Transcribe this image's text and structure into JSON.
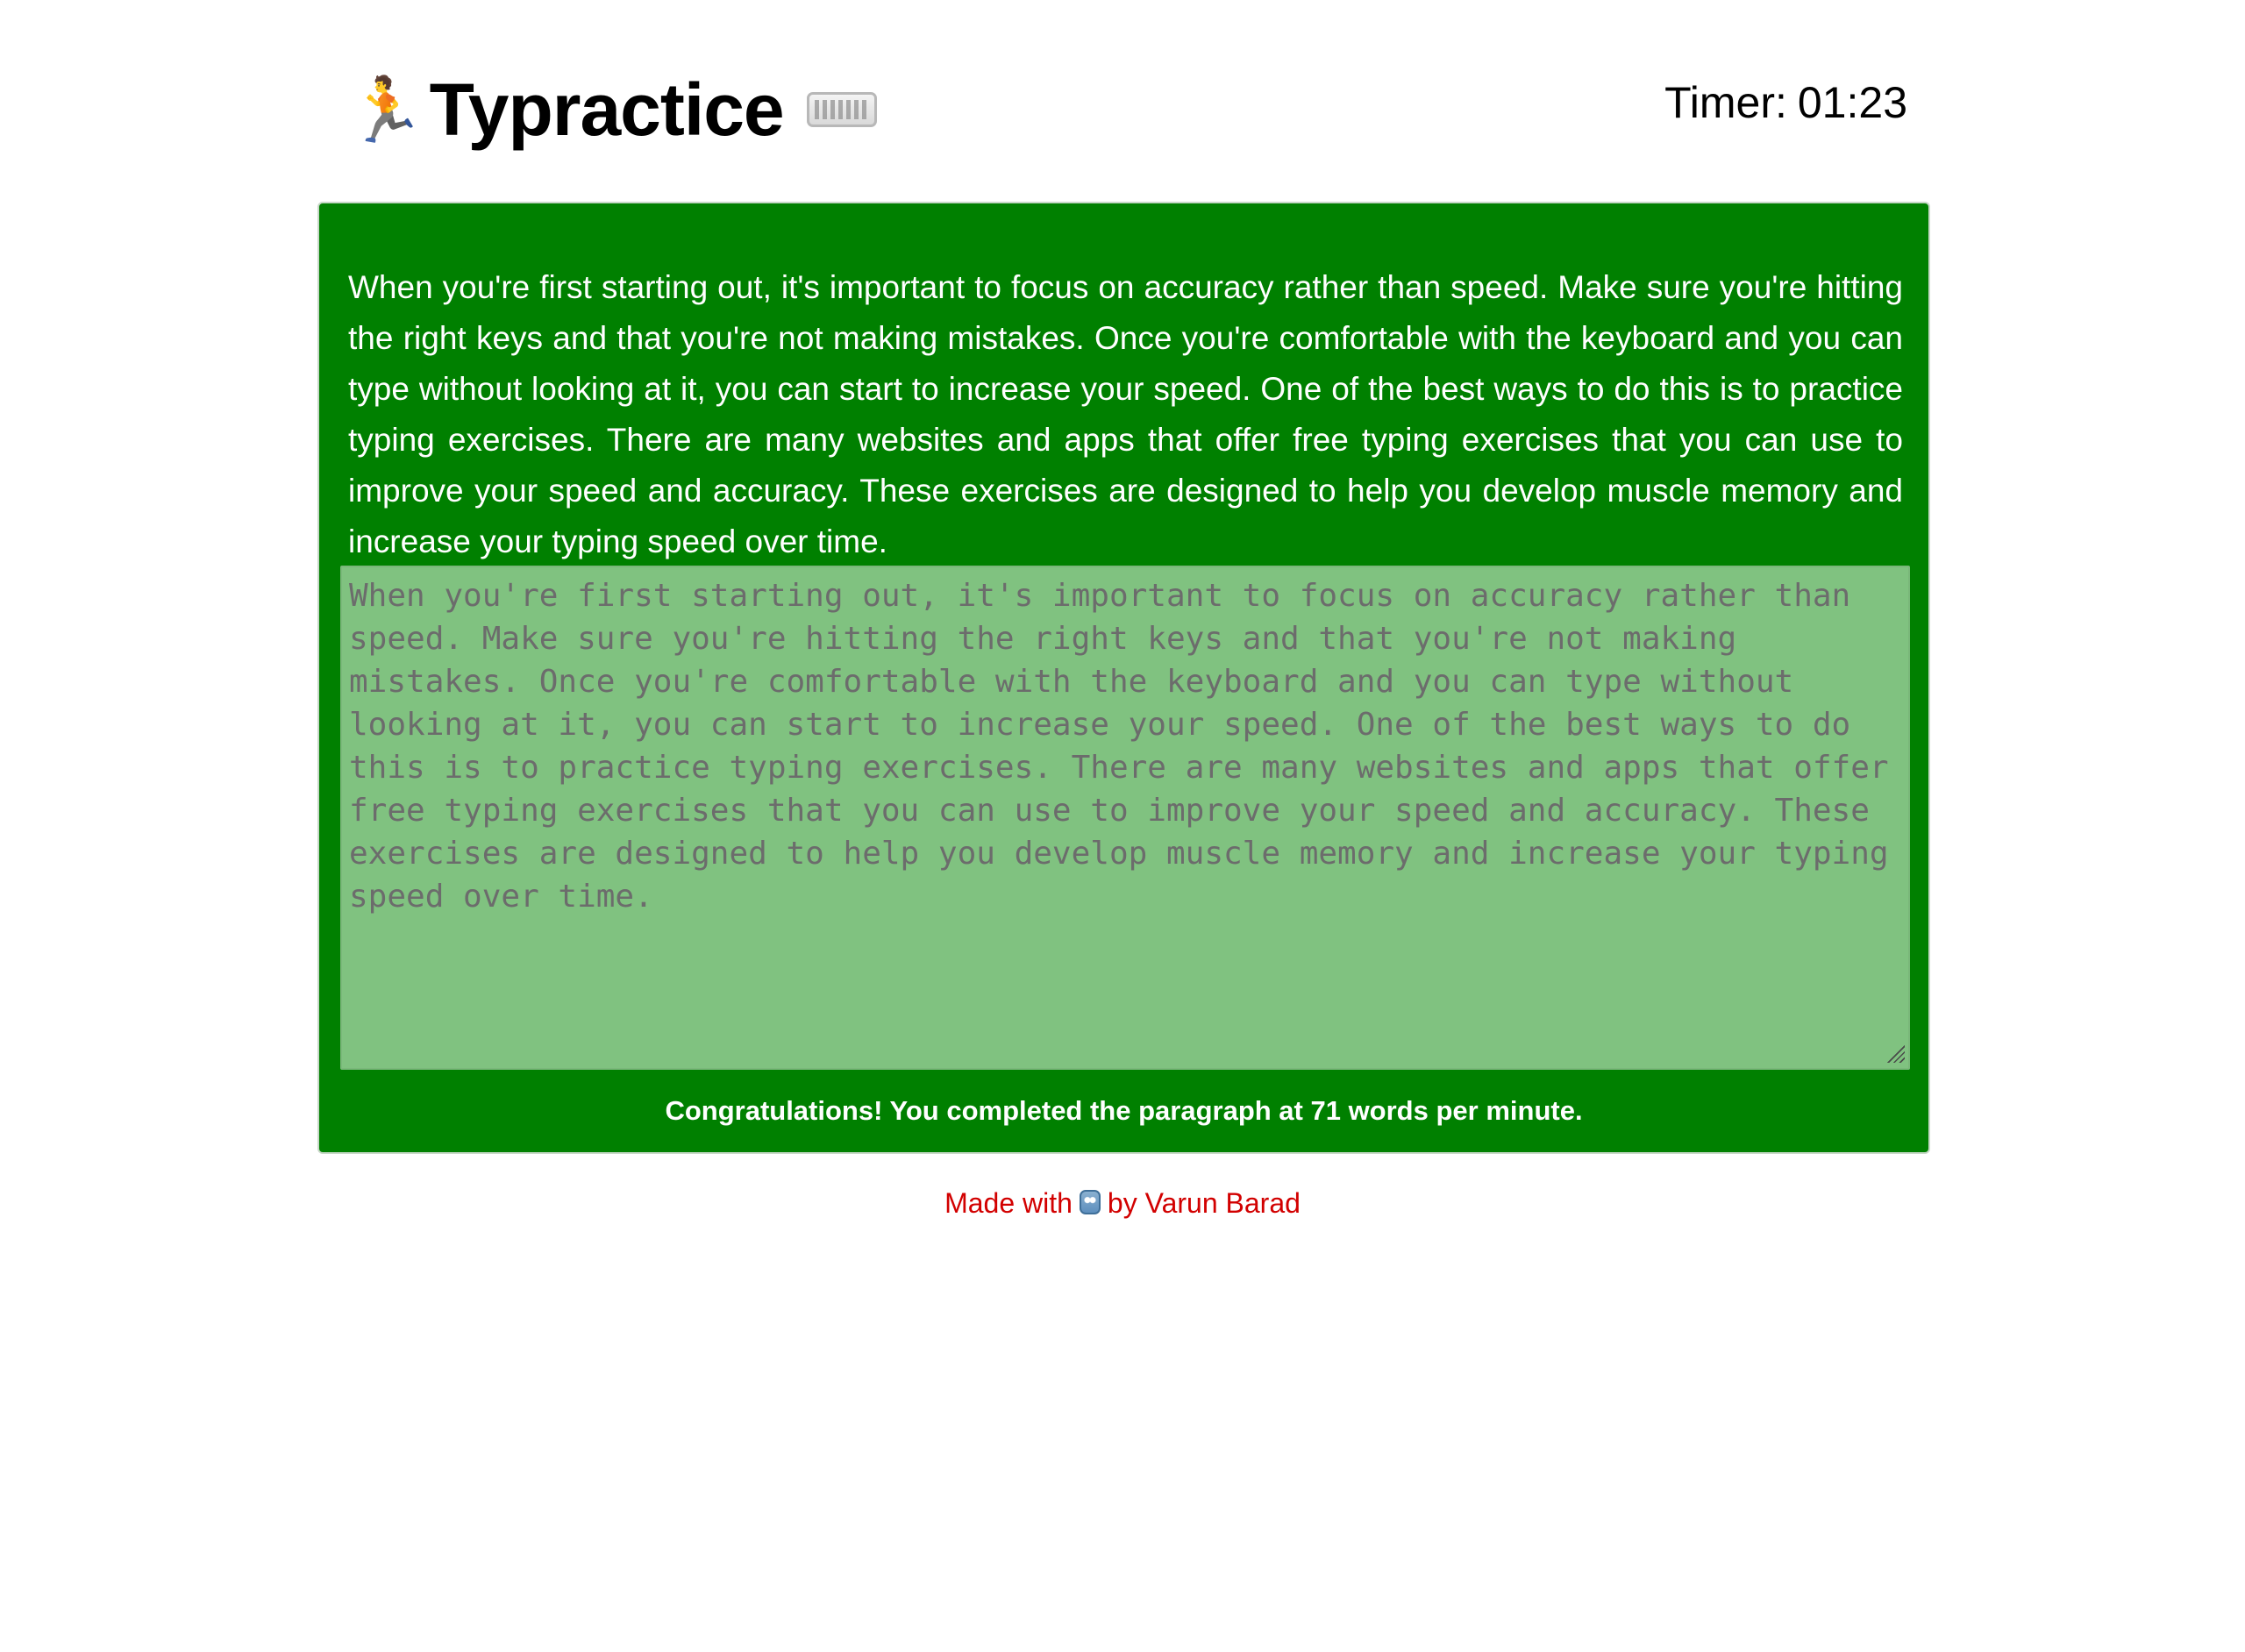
{
  "header": {
    "runner_icon": "🏃",
    "title": "Typractice",
    "timer_label": "Timer:",
    "timer_value": "01:23"
  },
  "prompt": {
    "text": "When you're first starting out, it's important to focus on accuracy rather than speed. Make sure you're hitting the right keys and that you're not making mistakes. Once you're comfortable with the keyboard and you can type without looking at it, you can start to increase your speed. One of the best ways to do this is to practice typing exercises. There are many websites and apps that offer free typing exercises that you can use to improve your speed and accuracy. These exercises are designed to help you develop muscle memory and increase your typing speed over time."
  },
  "typing_area": {
    "value": "When you're first starting out, it's important to focus on accuracy rather than speed. Make sure you're hitting the right keys and that you're not making mistakes. Once you're comfortable with the keyboard and you can type without looking at it, you can start to increase your speed. One of the best ways to do this is to practice typing exercises. There are many websites and apps that offer free typing exercises that you can use to improve your speed and accuracy. These exercises are designed to help you develop muscle memory and increase your typing speed over time."
  },
  "result": {
    "message": "Congratulations! You completed the paragraph at 71 words per minute."
  },
  "footer": {
    "prefix": "Made with",
    "suffix": "by Varun Barad"
  },
  "colors": {
    "panel_green": "#008000",
    "typing_area_green": "#80c280",
    "footer_red": "#d20000"
  },
  "icons": [
    "runner-icon",
    "keyboard-icon",
    "robot-icon",
    "resize-grip-icon"
  ]
}
